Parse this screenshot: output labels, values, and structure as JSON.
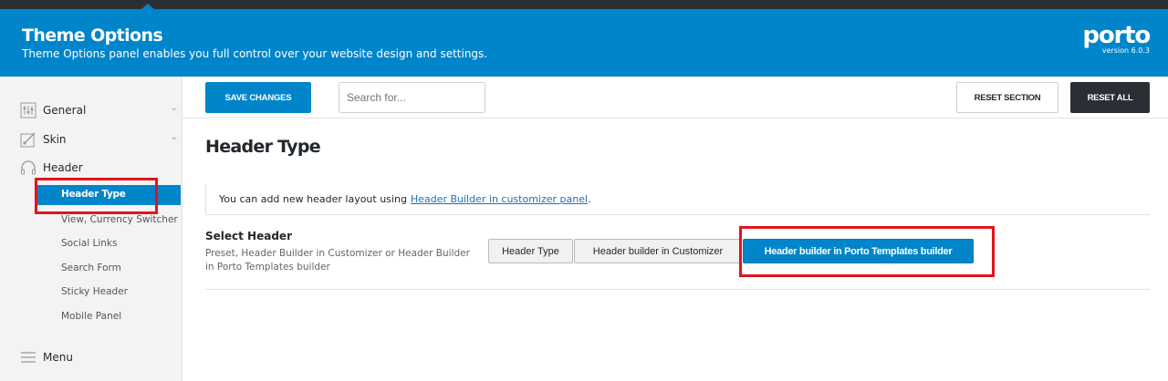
{
  "banner": {
    "title": "Theme Options",
    "subtitle": "Theme Options panel enables you full control over your website design and settings.",
    "logo_text": "porto",
    "version": "version 6.0.3"
  },
  "toolbar": {
    "save_label": "SAVE CHANGES",
    "search_placeholder": "Search for...",
    "reset_section_label": "RESET SECTION",
    "reset_all_label": "RESET ALL"
  },
  "sidebar": {
    "sections": [
      {
        "label": "General",
        "icon": "sliders-icon"
      },
      {
        "label": "Skin",
        "icon": "brush-icon"
      },
      {
        "label": "Header",
        "icon": "headphones-icon"
      }
    ],
    "header_sub_items": [
      "Header Type",
      "View, Currency Switcher",
      "Social Links",
      "Search Form",
      "Sticky Header",
      "Mobile Panel"
    ],
    "active_sub_item": "Header Type",
    "menu_label": "Menu"
  },
  "main": {
    "title": "Header Type",
    "notice_text": "You can add new header layout using",
    "notice_link": "Header Builder in customizer panel",
    "notice_end": ".",
    "field_title": "Select Header",
    "field_desc": "Preset, Header Builder in Customizer or Header Builder in Porto Templates builder",
    "options": [
      "Header Type",
      "Header builder in Customizer",
      "Header builder in Porto Templates builder"
    ],
    "selected_option": "Header builder in Porto Templates builder"
  },
  "colors": {
    "accent": "#0085cb",
    "dark": "#2a2f35",
    "highlight_box": "#e0141e"
  }
}
